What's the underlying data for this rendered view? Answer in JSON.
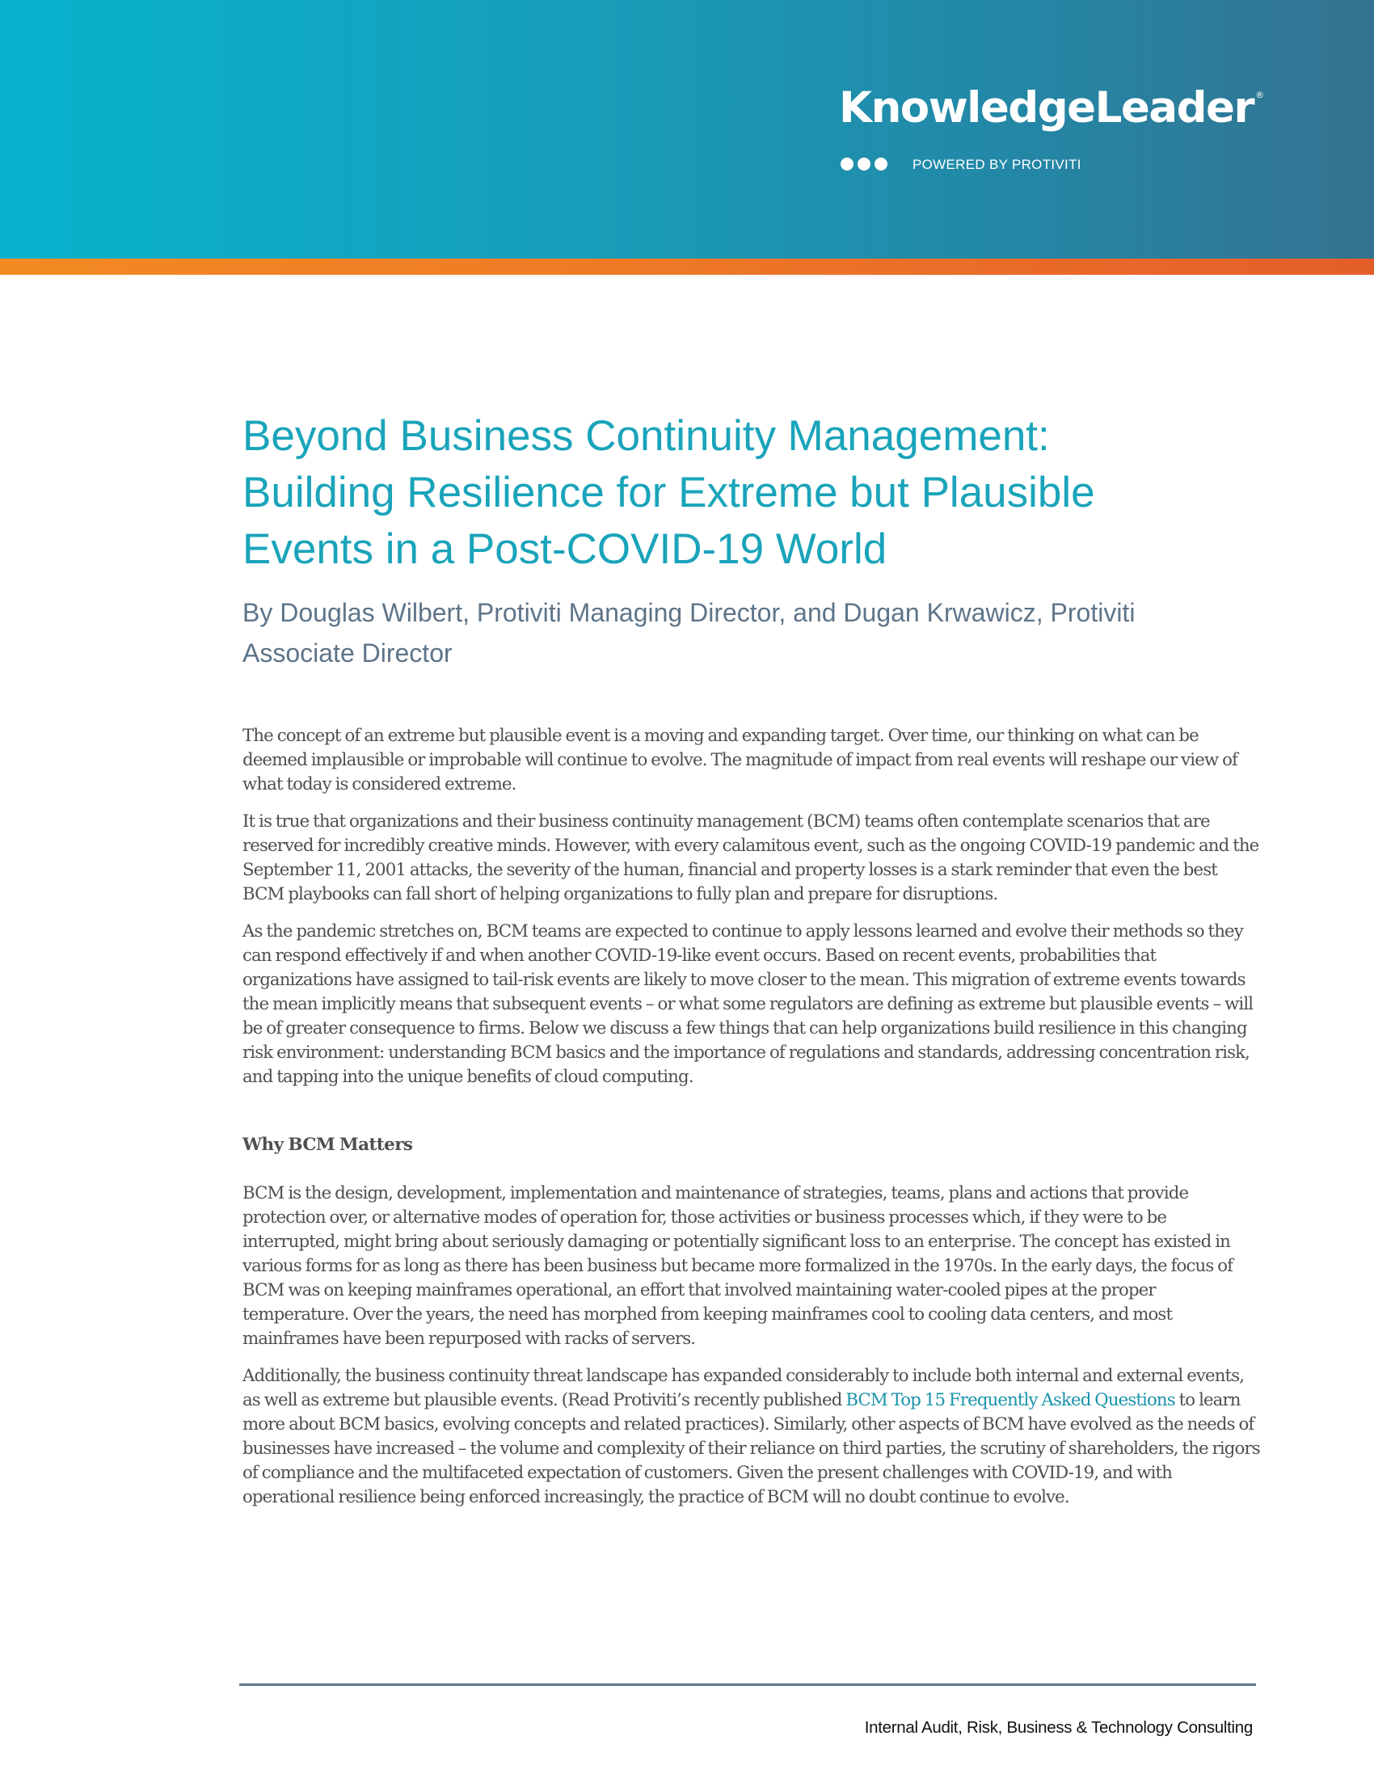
{
  "header": {
    "logo_text": "KnowledgeLeader",
    "logo_mark": "®",
    "tagline": "POWERED BY PROTIVITI",
    "colors": {
      "gradient_start": "#07b3cd",
      "gradient_end": "#347390",
      "band_start": "#f28a22",
      "band_end": "#e45e2a"
    }
  },
  "article": {
    "title_lines": [
      "Beyond Business Continuity Management:",
      "Building Resilience for Extreme but Plausible",
      "Events in a Post-COVID-19 World"
    ],
    "byline_lines": [
      "By Douglas Wilbert, Protiviti Managing Director, and Dugan Krwawicz, Protiviti",
      "Associate Director"
    ],
    "paragraphs": [
      "The concept of an extreme but plausible event is a moving and expanding target. Over time, our thinking on what can be deemed implausible or improbable will continue to evolve. The magnitude of impact from real events will reshape our view of what today is considered extreme.",
      "It is true that organizations and their business continuity management (BCM) teams often contemplate scenarios that are reserved for incredibly creative minds. However, with every calamitous event, such as the ongoing COVID-19 pandemic and the September 11, 2001 attacks, the severity of the human, financial and property losses is a stark reminder that even the best BCM playbooks can fall short of helping organizations to fully plan and prepare for disruptions.",
      "As the pandemic stretches on, BCM teams are expected to continue to apply lessons learned and evolve their methods so they can respond effectively if and when another COVID-19-like event occurs. Based on recent events, probabilities that organizations have assigned to tail-risk events are likely to move closer to the mean. This migration of extreme events towards the mean implicitly means that subsequent events – or what some regulators are defining as extreme but plausible events – will be of greater consequence to firms. Below we discuss a few things that can help organizations build resilience in this changing risk environment: understanding BCM basics and the importance of regulations and standards, addressing concentration risk, and tapping into the unique benefits of cloud computing."
    ],
    "section_heading": "Why BCM Matters",
    "section_paragraph_1": "BCM is the design, development, implementation and maintenance of strategies, teams, plans and actions that provide protection over, or alternative modes of operation for, those activities or business processes which, if they were to be interrupted, might bring about seriously damaging or potentially significant loss to an enterprise. The concept has existed in various forms for as long as there has been business but became more formalized in the 1970s. In the early days, the focus of BCM was on keeping mainframes operational, an effort that involved maintaining water-cooled pipes at the proper temperature. Over the years, the need has morphed from keeping mainframes cool to cooling data centers, and most mainframes have been repurposed with racks of servers.",
    "section_paragraph_2": {
      "before_link": "Additionally, the business continuity threat landscape has expanded considerably to include both internal and external events, as well as extreme but plausible events. (Read Protiviti’s recently published ",
      "link_text": "BCM Top 15 Frequently Asked Questions",
      "after_link": " to learn more about BCM basics, evolving concepts and related practices). Similarly, other aspects of BCM have evolved as the needs of businesses have increased – the volume and complexity of their reliance on third parties, the scrutiny of shareholders, the rigors of compliance and the multifaceted expectation of customers. Given the present challenges with COVID-19, and with operational resilience being enforced increasingly, the practice of BCM will no doubt continue to evolve."
    },
    "colors": {
      "title": "#1aa4ba",
      "byline": "#5e7488",
      "body": "#4f4f4f",
      "link": "#1a93ab"
    }
  },
  "footer": {
    "text": "Internal Audit, Risk, Business & Technology Consulting"
  }
}
